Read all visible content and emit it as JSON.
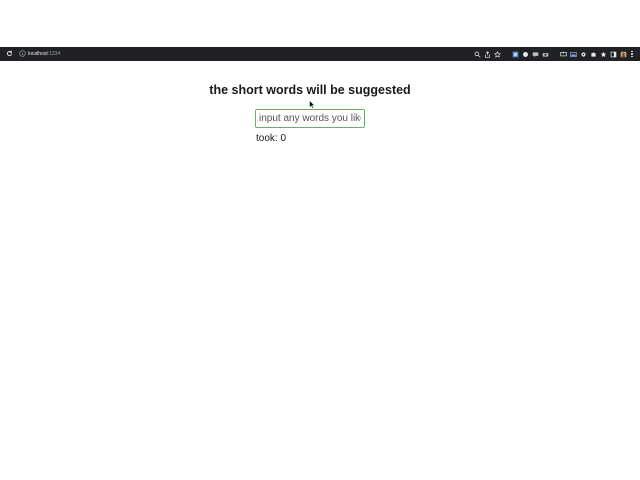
{
  "browser": {
    "url_host": "localhost",
    "url_port": ":1234",
    "toolbar_icons": [
      "search-icon",
      "share-icon",
      "star-icon",
      "extension-icon",
      "chat-icon",
      "comment-icon",
      "camera-icon",
      "screen-icon",
      "cast-icon",
      "settings-icon",
      "puzzle-icon",
      "bookmark-icon",
      "sidepanel-icon",
      "profile-icon"
    ]
  },
  "page": {
    "heading": "the short words will be suggested",
    "input_placeholder": "input any words you like",
    "input_value": "",
    "took_label": "took:",
    "took_value": "0"
  },
  "colors": {
    "toolbar_bg": "#202124",
    "input_border": "#5cb85c",
    "text": "#1a1a1a"
  }
}
